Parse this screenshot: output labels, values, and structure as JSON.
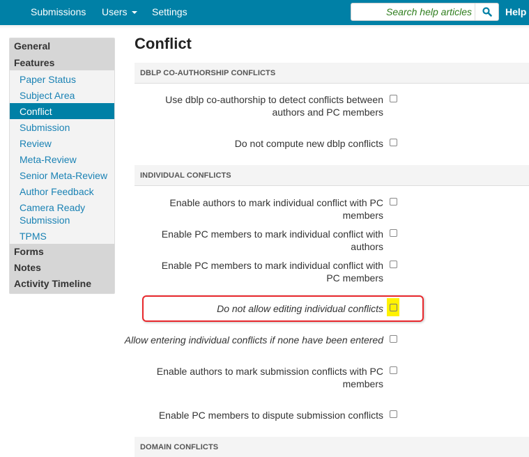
{
  "nav": {
    "items": [
      {
        "label": "Submissions"
      },
      {
        "label": "Users",
        "has_dropdown": true
      },
      {
        "label": "Settings"
      }
    ],
    "search": {
      "placeholder": "Search help articles",
      "icon": "search-icon"
    },
    "help_label": "Help",
    "bar_color": "#0080a6"
  },
  "sidebar": {
    "groups": [
      {
        "label": "General"
      },
      {
        "label": "Features",
        "items": [
          {
            "label": "Paper Status"
          },
          {
            "label": "Subject Area"
          },
          {
            "label": "Conflict",
            "active": true
          },
          {
            "label": "Submission"
          },
          {
            "label": "Review"
          },
          {
            "label": "Meta-Review"
          },
          {
            "label": "Senior Meta-Review"
          },
          {
            "label": "Author Feedback"
          },
          {
            "label": "Camera Ready Submission"
          },
          {
            "label": "TPMS"
          }
        ]
      },
      {
        "label": "Forms"
      },
      {
        "label": "Notes"
      },
      {
        "label": "Activity Timeline"
      }
    ]
  },
  "main": {
    "title": "Conflict",
    "sections": [
      {
        "header": "DBLP CO-AUTHORSHIP CONFLICTS",
        "settings": [
          {
            "label": "Use dblp co-authorship to detect conflicts between authors and PC members",
            "checked": false
          },
          {
            "label": "Do not compute new dblp conflicts",
            "checked": false
          }
        ]
      },
      {
        "header": "INDIVIDUAL CONFLICTS",
        "settings": [
          {
            "label": "Enable authors to mark individual conflict with PC members",
            "checked": false
          },
          {
            "label": "Enable PC members to mark individual conflict with authors",
            "checked": false
          },
          {
            "label": "Enable PC members to mark individual conflict with PC members",
            "checked": false
          },
          {
            "label": "Do not allow editing individual conflicts",
            "checked": false,
            "italic": true,
            "highlighted": true
          },
          {
            "label": "Allow entering individual conflicts if none have been entered",
            "checked": false,
            "italic": true
          },
          {
            "label": "Enable authors to mark submission conflicts with PC members",
            "checked": false
          },
          {
            "label": "Enable PC members to dispute submission conflicts",
            "checked": false
          }
        ]
      },
      {
        "header": "DOMAIN CONFLICTS",
        "settings": []
      }
    ]
  },
  "annotation": {
    "outline_color": "#e8282c",
    "marker_color": "#fff200"
  }
}
